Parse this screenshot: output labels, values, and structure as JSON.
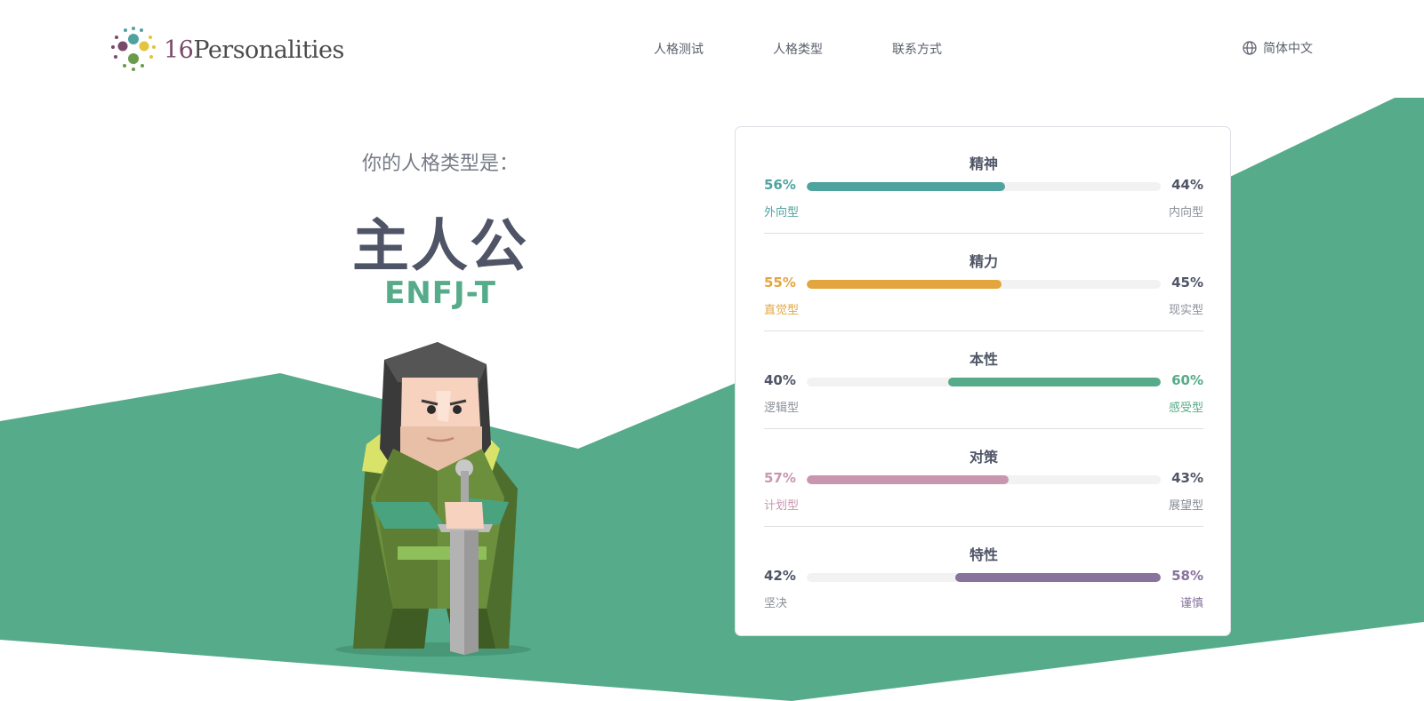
{
  "header": {
    "logo_number": "16",
    "logo_word": "Personalities",
    "nav": [
      "人格测试",
      "人格类型",
      "联系方式"
    ],
    "language": "简体中文"
  },
  "result": {
    "intro": "你的人格类型是：",
    "type_name": "主人公",
    "type_code": "ENFJ-T"
  },
  "colors": {
    "brand_green": "#56ab8a",
    "mind": "#4fa39f",
    "energy": "#e3a63f",
    "nature": "#56ab8a",
    "tactics": "#c996b0",
    "identity": "#87739c"
  },
  "traits": [
    {
      "title": "精神",
      "left_pct": "56%",
      "right_pct": "44%",
      "left_label": "外向型",
      "right_label": "内向型",
      "fill_fraction": 0.56,
      "dominant": "left",
      "color": "#4fa39f"
    },
    {
      "title": "精力",
      "left_pct": "55%",
      "right_pct": "45%",
      "left_label": "直觉型",
      "right_label": "现实型",
      "fill_fraction": 0.55,
      "dominant": "left",
      "color": "#e3a63f"
    },
    {
      "title": "本性",
      "left_pct": "40%",
      "right_pct": "60%",
      "left_label": "逻辑型",
      "right_label": "感受型",
      "fill_fraction": 0.6,
      "dominant": "right",
      "color": "#56ab8a"
    },
    {
      "title": "对策",
      "left_pct": "57%",
      "right_pct": "43%",
      "left_label": "计划型",
      "right_label": "展望型",
      "fill_fraction": 0.57,
      "dominant": "left",
      "color": "#c996b0"
    },
    {
      "title": "特性",
      "left_pct": "42%",
      "right_pct": "58%",
      "left_label": "坚决",
      "right_label": "谨慎",
      "fill_fraction": 0.58,
      "dominant": "right",
      "color": "#87739c"
    }
  ]
}
